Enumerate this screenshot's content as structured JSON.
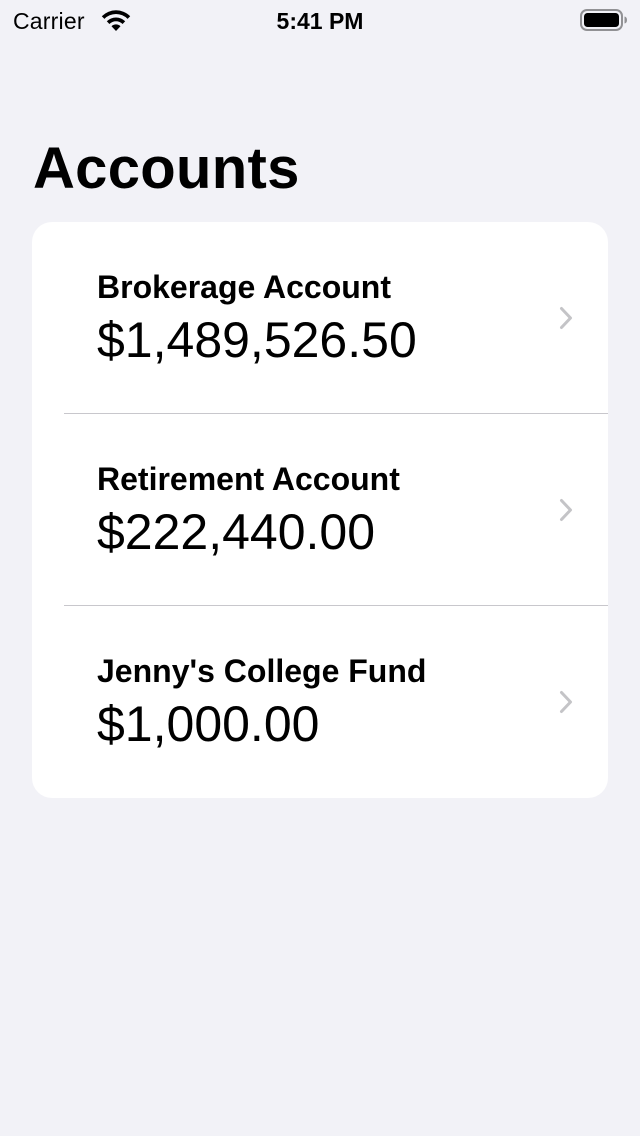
{
  "status_bar": {
    "carrier": "Carrier",
    "time": "5:41 PM"
  },
  "title": "Accounts",
  "accounts": [
    {
      "name": "Brokerage Account",
      "balance": "$1,489,526.50"
    },
    {
      "name": "Retirement Account",
      "balance": "$222,440.00"
    },
    {
      "name": "Jenny's College Fund",
      "balance": "$1,000.00"
    }
  ],
  "colors": {
    "background": "#f2f2f7",
    "card": "#ffffff",
    "separator": "#c8c7cc",
    "chevron": "#c4c4c7"
  },
  "icons": {
    "wifi": "wifi-icon",
    "battery": "battery-icon",
    "disclosure": "chevron-right-icon"
  }
}
